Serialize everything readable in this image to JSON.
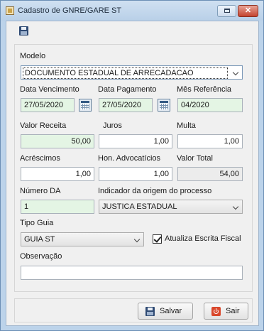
{
  "window": {
    "title": "Cadastro de GNRE/GARE ST"
  },
  "toolbar": {
    "save_icon": "floppy-disk-icon"
  },
  "form": {
    "modelo": {
      "label": "Modelo",
      "value": "DOCUMENTO ESTADUAL DE ARRECADACAO"
    },
    "data_vencimento": {
      "label": "Data Vencimento",
      "value": "27/05/2020"
    },
    "data_pagamento": {
      "label": "Data Pagamento",
      "value": "27/05/2020"
    },
    "mes_referencia": {
      "label": "Mês Referência",
      "value": "04/2020"
    },
    "valor_receita": {
      "label": "Valor Receita",
      "value": "50,00"
    },
    "juros": {
      "label": "Juros",
      "value": "1,00"
    },
    "multa": {
      "label": "Multa",
      "value": "1,00"
    },
    "acrescimos": {
      "label": "Acréscimos",
      "value": "1,00"
    },
    "hon_advocaticios": {
      "label": "Hon. Advocatícios",
      "value": "1,00"
    },
    "valor_total": {
      "label": "Valor Total",
      "value": "54,00"
    },
    "numero_da": {
      "label": "Número DA",
      "value": "1"
    },
    "indicador_origem": {
      "label": "Indicador da origem do processo",
      "value": "JUSTICA ESTADUAL"
    },
    "tipo_guia": {
      "label": "Tipo Guia",
      "value": "GUIA ST"
    },
    "atualiza_escrita_fiscal": {
      "label": "Atualiza Escrita Fiscal",
      "checked": true
    },
    "observacao": {
      "label": "Observação",
      "value": ""
    }
  },
  "buttons": {
    "salvar": "Salvar",
    "sair": "Sair"
  },
  "colors": {
    "title_bar": "#bcd3ea",
    "required_field": "#e4f5e4",
    "close_button": "#c4432f"
  }
}
